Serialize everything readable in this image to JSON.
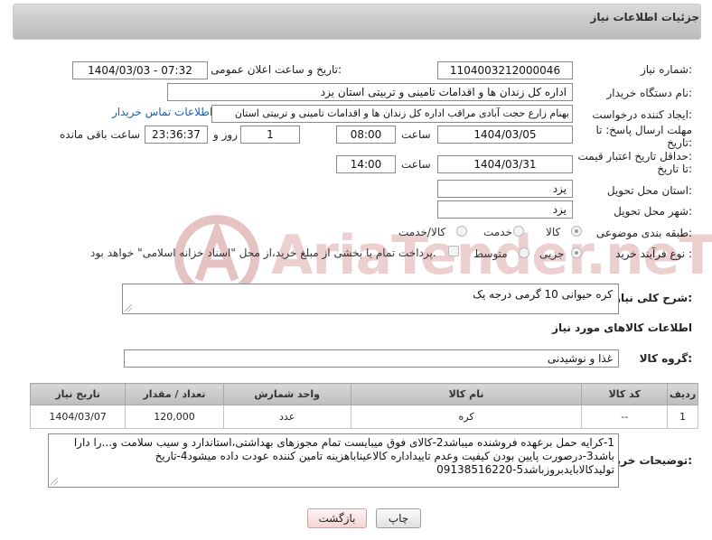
{
  "panel": {
    "title": "جزئیات اطلاعات نیاز"
  },
  "form": {
    "need_number": {
      "label": "شماره نیاز:",
      "value": "1104003212000046"
    },
    "announce": {
      "label": "تاریخ و ساعت اعلان عمومی:",
      "value": "1404/03/03 - 07:32"
    },
    "buyer_org": {
      "label": "نام دستگاه خریدار:",
      "value": "اداره کل زندان ها و اقدامات تامینی و تربیتی استان یزد"
    },
    "creator": {
      "label": "ایجاد کننده درخواست:",
      "value": "بهنام زارع حجت آبادی مراقب اداره کل زندان ها و اقدامات تامینی و تربیتی استان",
      "contact_link": "اطلاعات تماس خریدار"
    },
    "reply_deadline": {
      "label_line1": "مهلت ارسال پاسخ: تا",
      "label_line2": "تاریخ:",
      "date": "1404/03/05",
      "time_label": "ساعت",
      "time": "08:00",
      "days": "1",
      "days_label": "روز و",
      "remaining": "23:36:37",
      "remaining_label": "ساعت باقی مانده"
    },
    "price_validity": {
      "label_line1": "حداقل تاریخ اعتبار قیمت:",
      "label_line2": "تا تاریخ:",
      "date": "1404/03/31",
      "time_label": "ساعت",
      "time": "14:00"
    },
    "delivery_province": {
      "label": "استان محل تحویل:",
      "value": "یزد"
    },
    "delivery_city": {
      "label": "شهر محل تحویل:",
      "value": "یزد"
    },
    "category": {
      "label": "طبقه بندی موضوعی:",
      "options": [
        "کالا",
        "خدمت",
        "کالا/خدمت"
      ],
      "selected": "کالا"
    },
    "purchase_type": {
      "label": "نوع فرآیند خرید :",
      "options": [
        "جزیی",
        "متوسط"
      ],
      "note": "پرداخت تمام یا بخشی از مبلغ خرید،از محل \"اسناد خزانه اسلامی\" خواهد بود."
    }
  },
  "summary": {
    "label": "شرح کلی نیاز:",
    "value": "کره حیوانی 10 گرمی درجه یک"
  },
  "items_section": {
    "title": "اطلاعات کالاهای مورد نیاز"
  },
  "goods_group": {
    "label": "گروه کالا:",
    "value": "غذا و نوشیدنی"
  },
  "table": {
    "headers": [
      "ردیف",
      "کد کالا",
      "نام کالا",
      "واحد شمارش",
      "تعداد / مقدار",
      "تاریخ نیاز"
    ],
    "rows": [
      [
        "1",
        "--",
        "کره",
        "عدد",
        "120,000",
        "1404/03/07"
      ]
    ]
  },
  "buyer_notes": {
    "label": "توضیحات خریدار:",
    "value": "1-کرایه حمل برعهده فروشنده میباشد2-کالای فوق میبایست تمام مجوزهای بهداشتی،استاندارد و سیب سلامت و...را دارا باشد3-درصورت پایین بودن کیفیت وعدم تاییداداره کالاعیناباهزینه تامین کننده عودت داده میشود4-تاریخ تولیدکالابایدبروزباشد5-09138516220"
  },
  "buttons": {
    "print": "چاپ",
    "back": "بازگشت"
  },
  "watermark": {
    "text": "AriaTender.neT"
  },
  "colors": {
    "link": "#1a5fb4",
    "watermark": "#e3b8b8"
  }
}
